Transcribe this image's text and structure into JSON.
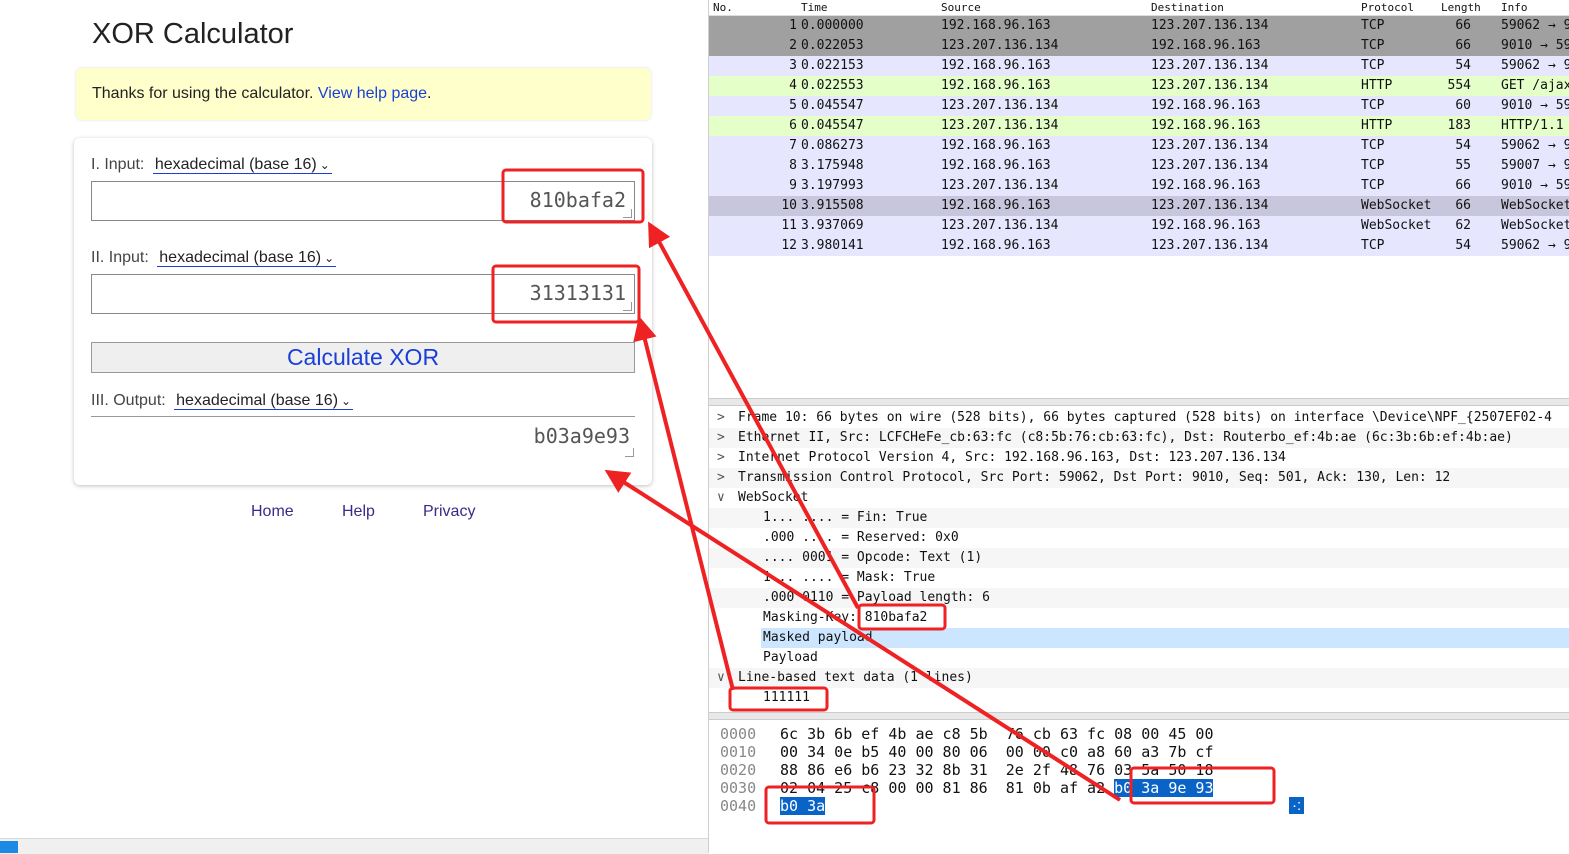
{
  "calculator": {
    "title": "XOR Calculator",
    "notice_text": "Thanks for using the calculator. ",
    "notice_link": "View help page",
    "notice_end": ".",
    "input1": {
      "label": "I. Input:",
      "format": "hexadecimal (base 16)",
      "value": "810bafa2"
    },
    "input2": {
      "label": "II. Input:",
      "format": "hexadecimal (base 16)",
      "value": "31313131"
    },
    "calculate_label": "Calculate XOR",
    "output": {
      "label": "III. Output:",
      "format": "hexadecimal (base 16)",
      "value": "b03a9e93"
    },
    "footer": {
      "home": "Home",
      "help": "Help",
      "privacy": "Privacy"
    }
  },
  "wireshark": {
    "columns": {
      "no": "No.",
      "time": "Time",
      "source": "Source",
      "destination": "Destination",
      "protocol": "Protocol",
      "length": "Length",
      "info": "Info"
    },
    "packets": [
      {
        "no": "1",
        "time": "0.000000",
        "src": "192.168.96.163",
        "dst": "123.207.136.134",
        "proto": "TCP",
        "len": "66",
        "info": "59062 → 9",
        "bg": "#a0a0a0"
      },
      {
        "no": "2",
        "time": "0.022053",
        "src": "123.207.136.134",
        "dst": "192.168.96.163",
        "proto": "TCP",
        "len": "66",
        "info": "9010 → 59",
        "bg": "#a0a0a0"
      },
      {
        "no": "3",
        "time": "0.022153",
        "src": "192.168.96.163",
        "dst": "123.207.136.134",
        "proto": "TCP",
        "len": "54",
        "info": "59062 → 9",
        "bg": "#e7e6ff"
      },
      {
        "no": "4",
        "time": "0.022553",
        "src": "192.168.96.163",
        "dst": "123.207.136.134",
        "proto": "HTTP",
        "len": "554",
        "info": "GET /ajax",
        "bg": "#e4ffc7"
      },
      {
        "no": "5",
        "time": "0.045547",
        "src": "123.207.136.134",
        "dst": "192.168.96.163",
        "proto": "TCP",
        "len": "60",
        "info": "9010 → 59",
        "bg": "#e7e6ff"
      },
      {
        "no": "6",
        "time": "0.045547",
        "src": "123.207.136.134",
        "dst": "192.168.96.163",
        "proto": "HTTP",
        "len": "183",
        "info": "HTTP/1.1 1",
        "bg": "#e4ffc7"
      },
      {
        "no": "7",
        "time": "0.086273",
        "src": "192.168.96.163",
        "dst": "123.207.136.134",
        "proto": "TCP",
        "len": "54",
        "info": "59062 → 9",
        "bg": "#e7e6ff"
      },
      {
        "no": "8",
        "time": "3.175948",
        "src": "192.168.96.163",
        "dst": "123.207.136.134",
        "proto": "TCP",
        "len": "55",
        "info": "59007 → 9",
        "bg": "#e7e6ff"
      },
      {
        "no": "9",
        "time": "3.197993",
        "src": "123.207.136.134",
        "dst": "192.168.96.163",
        "proto": "TCP",
        "len": "66",
        "info": "9010 → 59",
        "bg": "#e7e6ff"
      },
      {
        "no": "10",
        "time": "3.915508",
        "src": "192.168.96.163",
        "dst": "123.207.136.134",
        "proto": "WebSocket",
        "len": "66",
        "info": "WebSocket",
        "bg": "#c8c6dc"
      },
      {
        "no": "11",
        "time": "3.937069",
        "src": "123.207.136.134",
        "dst": "192.168.96.163",
        "proto": "WebSocket",
        "len": "62",
        "info": "WebSocket",
        "bg": "#e7e6ff"
      },
      {
        "no": "12",
        "time": "3.980141",
        "src": "192.168.96.163",
        "dst": "123.207.136.134",
        "proto": "TCP",
        "len": "54",
        "info": "59062 → 9",
        "bg": "#e7e6ff"
      }
    ],
    "details": [
      {
        "arrow": ">",
        "text": "Frame 10: 66 bytes on wire (528 bits), 66 bytes captured (528 bits) on interface \\Device\\NPF_{2507EF02-4",
        "indent": 0
      },
      {
        "arrow": ">",
        "text": "Ethernet II, Src: LCFCHeFe_cb:63:fc (c8:5b:76:cb:63:fc), Dst: Routerbo_ef:4b:ae (6c:3b:6b:ef:4b:ae)",
        "indent": 0
      },
      {
        "arrow": ">",
        "text": "Internet Protocol Version 4, Src: 192.168.96.163, Dst: 123.207.136.134",
        "indent": 0
      },
      {
        "arrow": ">",
        "text": "Transmission Control Protocol, Src Port: 59062, Dst Port: 9010, Seq: 501, Ack: 130, Len: 12",
        "indent": 0
      },
      {
        "arrow": "∨",
        "text": "WebSocket",
        "indent": 0
      },
      {
        "arrow": "",
        "text": "1... .... = Fin: True",
        "indent": 1
      },
      {
        "arrow": "",
        "text": ".000 .... = Reserved: 0x0",
        "indent": 1
      },
      {
        "arrow": "",
        "text": ".... 0001 = Opcode: Text (1)",
        "indent": 1
      },
      {
        "arrow": "",
        "text": "1... .... = Mask: True",
        "indent": 1
      },
      {
        "arrow": "",
        "text": ".000 0110 = Payload length: 6",
        "indent": 1
      },
      {
        "arrow": "",
        "text": "Masking-Key: 810bafa2",
        "indent": 1
      },
      {
        "arrow": "",
        "text": "Masked payload",
        "indent": 1,
        "selected": true
      },
      {
        "arrow": "",
        "text": "Payload",
        "indent": 1
      },
      {
        "arrow": "∨",
        "text": "Line-based text data (1 lines)",
        "indent": 0
      },
      {
        "arrow": "",
        "text": "111111",
        "indent": 1
      }
    ],
    "hex": [
      {
        "off": "0000",
        "bytes": "6c 3b 6b ef 4b ae c8 5b  76 cb 63 fc 08 00 45 00",
        "hl": ""
      },
      {
        "off": "0010",
        "bytes": "00 34 0e b5 40 00 80 06  00 00 c0 a8 60 a3 7b cf",
        "hl": ""
      },
      {
        "off": "0020",
        "bytes": "88 86 e6 b6 23 32 8b 31  2e 2f 48 76 03 5a 50 18",
        "hl": ""
      },
      {
        "off": "0030",
        "bytes": "02 04 25 c8 00 00 81 86  81 0b af a2 ",
        "hl": "b0 3a 9e 93"
      },
      {
        "off": "0040",
        "bytes": "",
        "hl": "b0 3a"
      }
    ],
    "ascii_tail": "·:"
  }
}
